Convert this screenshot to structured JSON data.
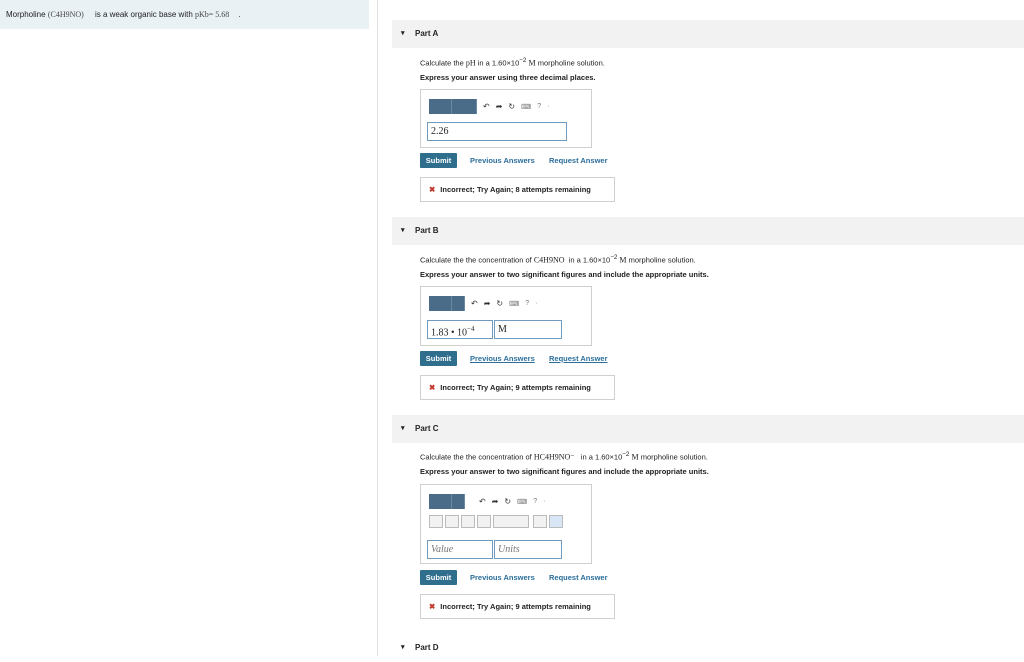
{
  "problem": {
    "intro_name": "Morpholine",
    "formula": "(C4H9NO)",
    "intro_tail": "is a weak organic base with",
    "pkb": "pKb= 5.68",
    "period": "."
  },
  "partA": {
    "title": "Part A",
    "question_pre": "Calculate the",
    "ph": "pH",
    "question_mid": "in a 1.60×10",
    "exp": "−2",
    "unit": "M",
    "question_post": "morpholine solution.",
    "instruction": "Express your answer using three decimal places.",
    "value": "2.26",
    "submit": "Submit",
    "previous": "Previous Answers",
    "request": "Request Answer",
    "feedback": "Incorrect; Try Again; 8 attempts remaining"
  },
  "partB": {
    "title": "Part B",
    "question_pre": "Calculate the the concentration of",
    "species": "C4H9NO",
    "question_mid": "in a 1.60×10",
    "exp": "−2",
    "unit": "M",
    "question_post": "morpholine solution.",
    "instruction": "Express your answer to two significant figures and include the appropriate units.",
    "value": "1.83 • 10",
    "value_exp": "−4",
    "units": "M",
    "submit": "Submit",
    "previous": "Previous Answers",
    "request": "Request Answer",
    "feedback": "Incorrect; Try Again; 9 attempts remaining"
  },
  "partC": {
    "title": "Part C",
    "question_pre": "Calculate the the concentration of",
    "species": "HC4H9NO⁻",
    "question_mid": "in a 1.60×10",
    "exp": "−2",
    "unit": "M",
    "question_post": "morpholine solution.",
    "instruction": "Express your answer to two significant figures and include the appropriate units.",
    "value_placeholder": "Value",
    "units_placeholder": "Units",
    "submit": "Submit",
    "previous": "Previous Answers",
    "request": "Request Answer",
    "feedback": "Incorrect; Try Again; 9 attempts remaining"
  },
  "partD": {
    "title": "Part D"
  },
  "colors": {
    "submit_bg": "#2f6e8d",
    "link": "#2b6e9b",
    "error": "#c0392b",
    "panel": "#e9f1f5"
  },
  "icons": [
    "undo-icon",
    "redo-icon",
    "reset-icon",
    "keyboard-icon",
    "help-icon"
  ]
}
